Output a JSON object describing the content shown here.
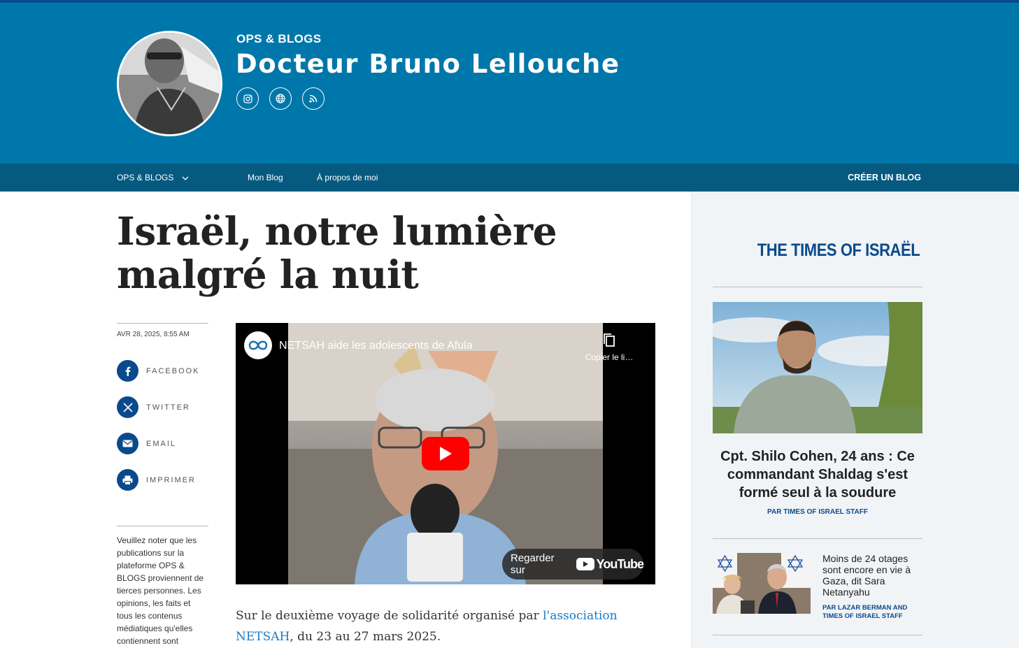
{
  "header": {
    "section": "OPS & BLOGS",
    "author_name": "Docteur Bruno Lellouche",
    "social_icons": [
      "instagram-icon",
      "globe-icon",
      "rss-icon"
    ]
  },
  "nav": {
    "ops_blogs": "OPS & BLOGS",
    "my_blog": "Mon Blog",
    "about": "À propos de moi",
    "create_blog": "CRÉER UN BLOG"
  },
  "article": {
    "headline": "Israël, notre lumière malgré la nuit",
    "date": "AVR 28, 2025, 8:55 AM",
    "share": [
      {
        "label": "FACEBOOK",
        "icon": "facebook-icon"
      },
      {
        "label": "TWITTER",
        "icon": "x-icon"
      },
      {
        "label": "EMAIL",
        "icon": "email-icon"
      },
      {
        "label": "IMPRIMER",
        "icon": "print-icon"
      }
    ],
    "disclaimer": "Veuillez noter que les publications sur la plateforme OPS & BLOGS proviennent de tierces personnes. Les opinions, les faits et tous les contenus médiatiques qu'elles contiennent sont",
    "body_before": "Sur le deuxième voyage de solidarité organisé par ",
    "body_link": "l'association NETSAH",
    "body_after": ", du 23 au 27 mars 2025."
  },
  "video": {
    "title": "NETSAH aide les adolescents de Afula",
    "copy_link": "Copier le li…",
    "watch_on": "Regarder sur",
    "youtube": "YouTube"
  },
  "sidebar": {
    "logo": "THE TIMES OF ISRAËL",
    "feature": {
      "title": "Cpt. Shilo Cohen, 24 ans : Ce commandant Shaldag s'est formé seul à la soudure",
      "byline": "PAR TIMES OF ISRAEL STAFF"
    },
    "small": {
      "title": "Moins de 24 otages sont encore en vie à Gaza, dit Sara Netanyahu",
      "byline": "PAR LAZAR BERMAN AND TIMES OF ISRAEL STAFF"
    }
  },
  "colors": {
    "header_blue": "#0077aa",
    "nav_blue": "#065a80",
    "brand_navy": "#0a4a8c",
    "link_blue": "#1a7ac8"
  }
}
